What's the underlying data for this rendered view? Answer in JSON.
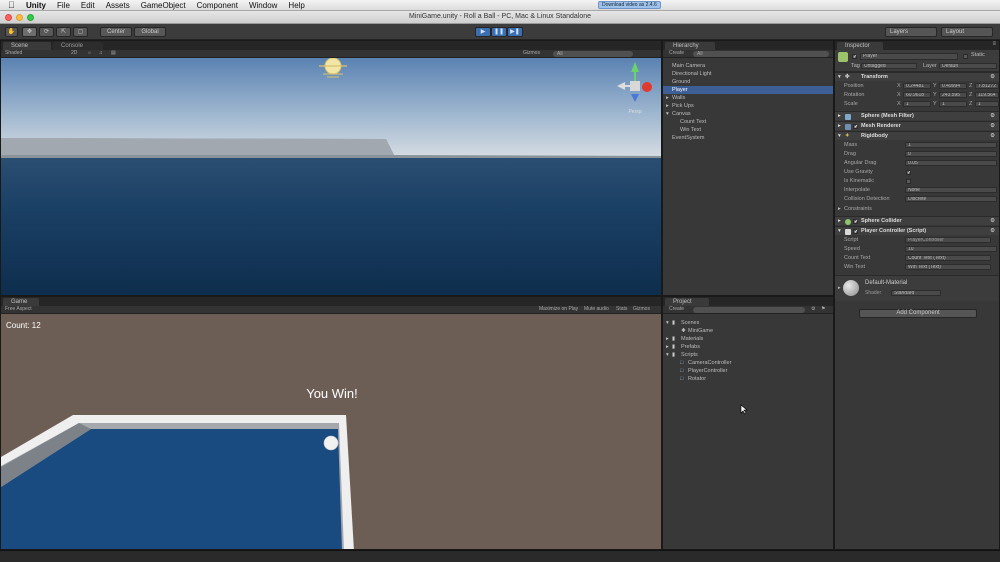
{
  "menubar": {
    "app": "Unity",
    "items": [
      "File",
      "Edit",
      "Assets",
      "GameObject",
      "Component",
      "Window",
      "Help"
    ],
    "download_badge": "Download video as 2.4.6"
  },
  "window": {
    "title": "MiniGame.unity - Roll a Ball - PC, Mac & Linux Standalone"
  },
  "toolbar": {
    "pivot": "Center",
    "space": "Global",
    "layers": "Layers",
    "layout": "Layout"
  },
  "scene": {
    "tabs": [
      "Scene",
      "Console"
    ],
    "shading": "Shaded",
    "mode2d": "2D",
    "gizmos": "Gizmos",
    "search": "All",
    "persp": "Persp"
  },
  "game": {
    "tab": "Game",
    "aspect": "Free Aspect",
    "options": [
      "Maximize on Play",
      "Mute audio",
      "Stats",
      "Gizmos"
    ],
    "count_text": "Count: 12",
    "win_text": "You Win!"
  },
  "hierarchy": {
    "tab": "Hierarchy",
    "create": "Create",
    "search": "All",
    "items": [
      {
        "label": "Main Camera",
        "depth": 0,
        "selected": false
      },
      {
        "label": "Directional Light",
        "depth": 0,
        "selected": false
      },
      {
        "label": "Ground",
        "depth": 0,
        "selected": false
      },
      {
        "label": "Player",
        "depth": 0,
        "selected": true
      },
      {
        "label": "Walls",
        "depth": 0,
        "selected": false
      },
      {
        "label": "Pick Ups",
        "depth": 0,
        "selected": false
      },
      {
        "label": "Canvas",
        "depth": 0,
        "selected": false
      },
      {
        "label": "Count Text",
        "depth": 1,
        "selected": false
      },
      {
        "label": "Win Text",
        "depth": 1,
        "selected": false
      },
      {
        "label": "EventSystem",
        "depth": 0,
        "selected": false
      }
    ]
  },
  "project": {
    "tab": "Project",
    "create": "Create",
    "items": [
      {
        "label": "Scenes",
        "depth": 0
      },
      {
        "label": "MiniGame",
        "depth": 1
      },
      {
        "label": "Materials",
        "depth": 0
      },
      {
        "label": "Prefabs",
        "depth": 0
      },
      {
        "label": "Scripts",
        "depth": 0
      },
      {
        "label": "CameraController",
        "depth": 1
      },
      {
        "label": "PlayerController",
        "depth": 1
      },
      {
        "label": "Rotator",
        "depth": 1
      }
    ]
  },
  "inspector": {
    "tab": "Inspector",
    "object_name": "Player",
    "static_label": "Static",
    "tag_label": "Tag",
    "tag_value": "Untagged",
    "layer_label": "Layer",
    "layer_value": "Default",
    "transform": {
      "header": "Transform",
      "position_label": "Position",
      "rotation_label": "Rotation",
      "scale_label": "Scale",
      "position": [
        "0.24481",
        "0.49994",
        "7.81272"
      ],
      "rotation": [
        "60.9618",
        "243.595",
        "119.564"
      ],
      "scale": [
        "1",
        "1",
        "1"
      ]
    },
    "mesh_filter": {
      "header": "Sphere (Mesh Filter)"
    },
    "mesh_renderer": {
      "header": "Mesh Renderer"
    },
    "rigidbody": {
      "header": "Rigidbody",
      "mass_label": "Mass",
      "mass": "1",
      "drag_label": "Drag",
      "drag": "0",
      "angular_drag_label": "Angular Drag",
      "angular_drag": "0.05",
      "use_gravity_label": "Use Gravity",
      "use_gravity": true,
      "is_kinematic_label": "Is Kinematic",
      "is_kinematic": false,
      "interpolate_label": "Interpolate",
      "interpolate": "None",
      "collision_label": "Collision Detection",
      "collision": "Discrete",
      "constraints_label": "Constraints"
    },
    "sphere_collider": {
      "header": "Sphere Collider"
    },
    "player_controller": {
      "header": "Player Controller (Script)",
      "script_label": "Script",
      "script": "PlayerController",
      "speed_label": "Speed",
      "speed": "10",
      "count_text_label": "Count Text",
      "count_text": "Count Text (Text)",
      "win_text_label": "Win Text",
      "win_text": "Win Text (Text)"
    },
    "material": {
      "name": "Default-Material",
      "shader_label": "Shader",
      "shader": "Standard"
    },
    "add_component": "Add Component"
  },
  "colors": {
    "sky_top": "#5e84b0",
    "sky_horizon": "#cdd7df",
    "water": "#183e62",
    "game_bg": "#6d5e55",
    "board_blue": "#1a4b80",
    "selection": "#3e5f96"
  }
}
